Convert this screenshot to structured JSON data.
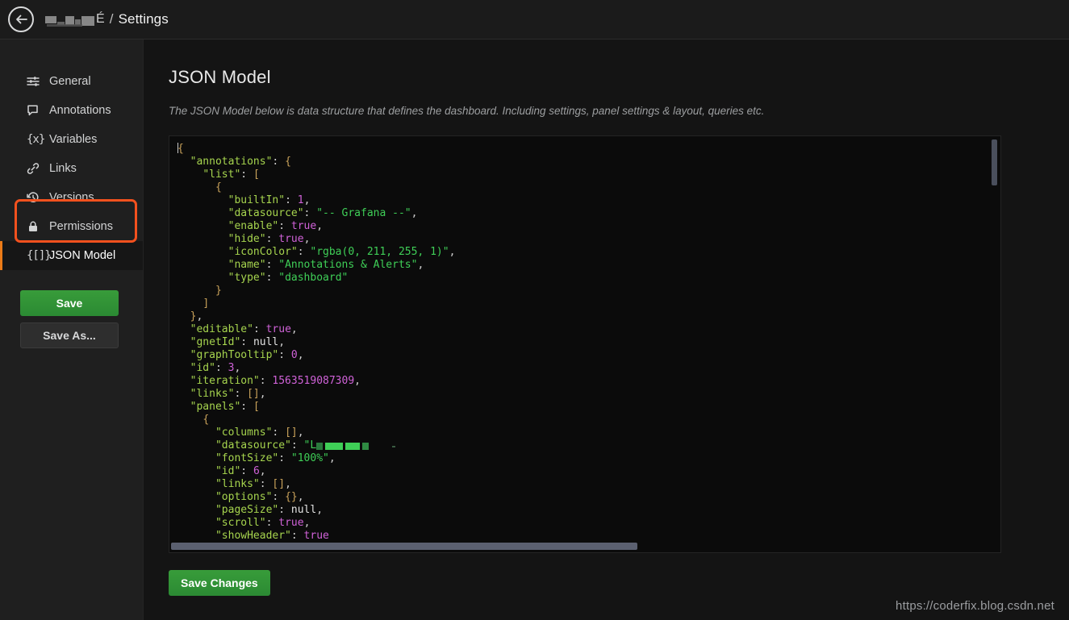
{
  "header": {
    "back_icon": "arrow-left-circle-icon",
    "breadcrumb_redacted_label": "",
    "breadcrumb_tail_char": "É",
    "breadcrumb_separator": "/",
    "breadcrumb_page": "Settings"
  },
  "sidebar": {
    "items": [
      {
        "id": "general",
        "label": "General",
        "icon": "sliders-icon",
        "icon_glyph": "",
        "active": false
      },
      {
        "id": "annotations",
        "label": "Annotations",
        "icon": "comment-icon",
        "icon_glyph": "",
        "active": false
      },
      {
        "id": "variables",
        "label": "Variables",
        "icon": "braces-x-icon",
        "icon_glyph": "{x}",
        "active": false
      },
      {
        "id": "links",
        "label": "Links",
        "icon": "link-icon",
        "icon_glyph": "",
        "active": false
      },
      {
        "id": "versions",
        "label": "Versions",
        "icon": "history-icon",
        "icon_glyph": "",
        "active": false
      },
      {
        "id": "permissions",
        "label": "Permissions",
        "icon": "lock-icon",
        "icon_glyph": "",
        "active": false
      },
      {
        "id": "json-model",
        "label": "JSON Model",
        "icon": "json-braces-icon",
        "icon_glyph": "{[]}",
        "active": true
      }
    ],
    "save_label": "Save",
    "save_as_label": "Save As...",
    "active_highlight_color": "#eb7b18",
    "annotation_box_color": "#f4511e"
  },
  "main": {
    "title": "JSON Model",
    "description": "The JSON Model below is data structure that defines the dashboard. Including settings, panel settings & layout, queries etc.",
    "save_changes_label": "Save Changes"
  },
  "editor": {
    "datasource_redacted_prefix": "\"L",
    "vertical_scroll_position": "top",
    "horizontal_scroll_position": "left",
    "lines": [
      [
        {
          "t": "punc",
          "v": "{"
        }
      ],
      [
        {
          "t": "plain",
          "v": "  "
        },
        {
          "t": "key",
          "v": "\"annotations\""
        },
        {
          "t": "plain",
          "v": ": "
        },
        {
          "t": "punc",
          "v": "{"
        }
      ],
      [
        {
          "t": "plain",
          "v": "    "
        },
        {
          "t": "key",
          "v": "\"list\""
        },
        {
          "t": "plain",
          "v": ": "
        },
        {
          "t": "punc",
          "v": "["
        }
      ],
      [
        {
          "t": "plain",
          "v": "      "
        },
        {
          "t": "punc",
          "v": "{"
        }
      ],
      [
        {
          "t": "plain",
          "v": "        "
        },
        {
          "t": "key",
          "v": "\"builtIn\""
        },
        {
          "t": "plain",
          "v": ": "
        },
        {
          "t": "num",
          "v": "1"
        },
        {
          "t": "plain",
          "v": ","
        }
      ],
      [
        {
          "t": "plain",
          "v": "        "
        },
        {
          "t": "key",
          "v": "\"datasource\""
        },
        {
          "t": "plain",
          "v": ": "
        },
        {
          "t": "str",
          "v": "\"-- Grafana --\""
        },
        {
          "t": "plain",
          "v": ","
        }
      ],
      [
        {
          "t": "plain",
          "v": "        "
        },
        {
          "t": "key",
          "v": "\"enable\""
        },
        {
          "t": "plain",
          "v": ": "
        },
        {
          "t": "bool",
          "v": "true"
        },
        {
          "t": "plain",
          "v": ","
        }
      ],
      [
        {
          "t": "plain",
          "v": "        "
        },
        {
          "t": "key",
          "v": "\"hide\""
        },
        {
          "t": "plain",
          "v": ": "
        },
        {
          "t": "bool",
          "v": "true"
        },
        {
          "t": "plain",
          "v": ","
        }
      ],
      [
        {
          "t": "plain",
          "v": "        "
        },
        {
          "t": "key",
          "v": "\"iconColor\""
        },
        {
          "t": "plain",
          "v": ": "
        },
        {
          "t": "str",
          "v": "\"rgba(0, 211, 255, 1)\""
        },
        {
          "t": "plain",
          "v": ","
        }
      ],
      [
        {
          "t": "plain",
          "v": "        "
        },
        {
          "t": "key",
          "v": "\"name\""
        },
        {
          "t": "plain",
          "v": ": "
        },
        {
          "t": "str",
          "v": "\"Annotations & Alerts\""
        },
        {
          "t": "plain",
          "v": ","
        }
      ],
      [
        {
          "t": "plain",
          "v": "        "
        },
        {
          "t": "key",
          "v": "\"type\""
        },
        {
          "t": "plain",
          "v": ": "
        },
        {
          "t": "str",
          "v": "\"dashboard\""
        }
      ],
      [
        {
          "t": "plain",
          "v": "      "
        },
        {
          "t": "punc",
          "v": "}"
        }
      ],
      [
        {
          "t": "plain",
          "v": "    "
        },
        {
          "t": "punc",
          "v": "]"
        }
      ],
      [
        {
          "t": "plain",
          "v": "  "
        },
        {
          "t": "punc",
          "v": "}"
        },
        {
          "t": "plain",
          "v": ","
        }
      ],
      [
        {
          "t": "plain",
          "v": "  "
        },
        {
          "t": "key",
          "v": "\"editable\""
        },
        {
          "t": "plain",
          "v": ": "
        },
        {
          "t": "bool",
          "v": "true"
        },
        {
          "t": "plain",
          "v": ","
        }
      ],
      [
        {
          "t": "plain",
          "v": "  "
        },
        {
          "t": "key",
          "v": "\"gnetId\""
        },
        {
          "t": "plain",
          "v": ": "
        },
        {
          "t": "null",
          "v": "null"
        },
        {
          "t": "plain",
          "v": ","
        }
      ],
      [
        {
          "t": "plain",
          "v": "  "
        },
        {
          "t": "key",
          "v": "\"graphTooltip\""
        },
        {
          "t": "plain",
          "v": ": "
        },
        {
          "t": "num",
          "v": "0"
        },
        {
          "t": "plain",
          "v": ","
        }
      ],
      [
        {
          "t": "plain",
          "v": "  "
        },
        {
          "t": "key",
          "v": "\"id\""
        },
        {
          "t": "plain",
          "v": ": "
        },
        {
          "t": "num",
          "v": "3"
        },
        {
          "t": "plain",
          "v": ","
        }
      ],
      [
        {
          "t": "plain",
          "v": "  "
        },
        {
          "t": "key",
          "v": "\"iteration\""
        },
        {
          "t": "plain",
          "v": ": "
        },
        {
          "t": "num",
          "v": "1563519087309"
        },
        {
          "t": "plain",
          "v": ","
        }
      ],
      [
        {
          "t": "plain",
          "v": "  "
        },
        {
          "t": "key",
          "v": "\"links\""
        },
        {
          "t": "plain",
          "v": ": "
        },
        {
          "t": "punc",
          "v": "[]"
        },
        {
          "t": "plain",
          "v": ","
        }
      ],
      [
        {
          "t": "plain",
          "v": "  "
        },
        {
          "t": "key",
          "v": "\"panels\""
        },
        {
          "t": "plain",
          "v": ": "
        },
        {
          "t": "punc",
          "v": "["
        }
      ],
      [
        {
          "t": "plain",
          "v": "    "
        },
        {
          "t": "punc",
          "v": "{"
        }
      ],
      [
        {
          "t": "plain",
          "v": "      "
        },
        {
          "t": "key",
          "v": "\"columns\""
        },
        {
          "t": "plain",
          "v": ": "
        },
        {
          "t": "punc",
          "v": "[]"
        },
        {
          "t": "plain",
          "v": ","
        }
      ],
      [
        {
          "t": "plain",
          "v": "      "
        },
        {
          "t": "key",
          "v": "\"datasource\""
        },
        {
          "t": "plain",
          "v": ": "
        },
        {
          "t": "redact",
          "v": "\"L"
        }
      ],
      [
        {
          "t": "plain",
          "v": "      "
        },
        {
          "t": "key",
          "v": "\"fontSize\""
        },
        {
          "t": "plain",
          "v": ": "
        },
        {
          "t": "str",
          "v": "\"100%\""
        },
        {
          "t": "plain",
          "v": ","
        }
      ],
      [
        {
          "t": "plain",
          "v": "      "
        },
        {
          "t": "key",
          "v": "\"id\""
        },
        {
          "t": "plain",
          "v": ": "
        },
        {
          "t": "num",
          "v": "6"
        },
        {
          "t": "plain",
          "v": ","
        }
      ],
      [
        {
          "t": "plain",
          "v": "      "
        },
        {
          "t": "key",
          "v": "\"links\""
        },
        {
          "t": "plain",
          "v": ": "
        },
        {
          "t": "punc",
          "v": "[]"
        },
        {
          "t": "plain",
          "v": ","
        }
      ],
      [
        {
          "t": "plain",
          "v": "      "
        },
        {
          "t": "key",
          "v": "\"options\""
        },
        {
          "t": "plain",
          "v": ": "
        },
        {
          "t": "punc",
          "v": "{}"
        },
        {
          "t": "plain",
          "v": ","
        }
      ],
      [
        {
          "t": "plain",
          "v": "      "
        },
        {
          "t": "key",
          "v": "\"pageSize\""
        },
        {
          "t": "plain",
          "v": ": "
        },
        {
          "t": "null",
          "v": "null"
        },
        {
          "t": "plain",
          "v": ","
        }
      ],
      [
        {
          "t": "plain",
          "v": "      "
        },
        {
          "t": "key",
          "v": "\"scroll\""
        },
        {
          "t": "plain",
          "v": ": "
        },
        {
          "t": "bool",
          "v": "true"
        },
        {
          "t": "plain",
          "v": ","
        }
      ],
      [
        {
          "t": "plain",
          "v": "      "
        },
        {
          "t": "key",
          "v": "\"showHeader\""
        },
        {
          "t": "plain",
          "v": ": "
        },
        {
          "t": "bool",
          "v": "true"
        }
      ]
    ]
  },
  "watermark": "https://coderfix.blog.csdn.net"
}
